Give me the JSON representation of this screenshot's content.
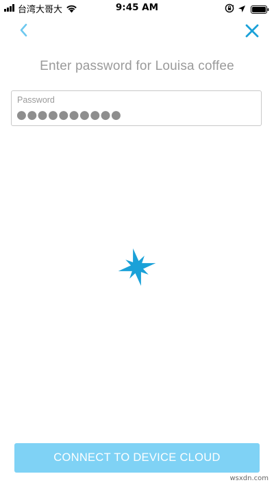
{
  "status_bar": {
    "carrier": "台湾大哥大",
    "time": "9:45 AM",
    "icons": [
      "signal-icon",
      "wifi-icon",
      "orientation-lock-icon",
      "location-arrow-icon",
      "battery-icon"
    ]
  },
  "nav": {
    "back_icon": "chevron-left-icon",
    "close_icon": "close-icon"
  },
  "page": {
    "title": "Enter password for Louisa coffee"
  },
  "password": {
    "label": "Password",
    "value": "●●●●●●●●●●"
  },
  "spinner": {
    "icon": "loading-spinner-icon",
    "color": "#1aa1d8"
  },
  "connect": {
    "label": "CONNECT TO DEVICE CLOUD",
    "color": "#7fd2f5"
  },
  "watermark": "wsxdn.com",
  "colors": {
    "accent": "#1aa1d8",
    "back_chevron": "#6dc8ef",
    "text_muted": "#9a9a9a"
  }
}
